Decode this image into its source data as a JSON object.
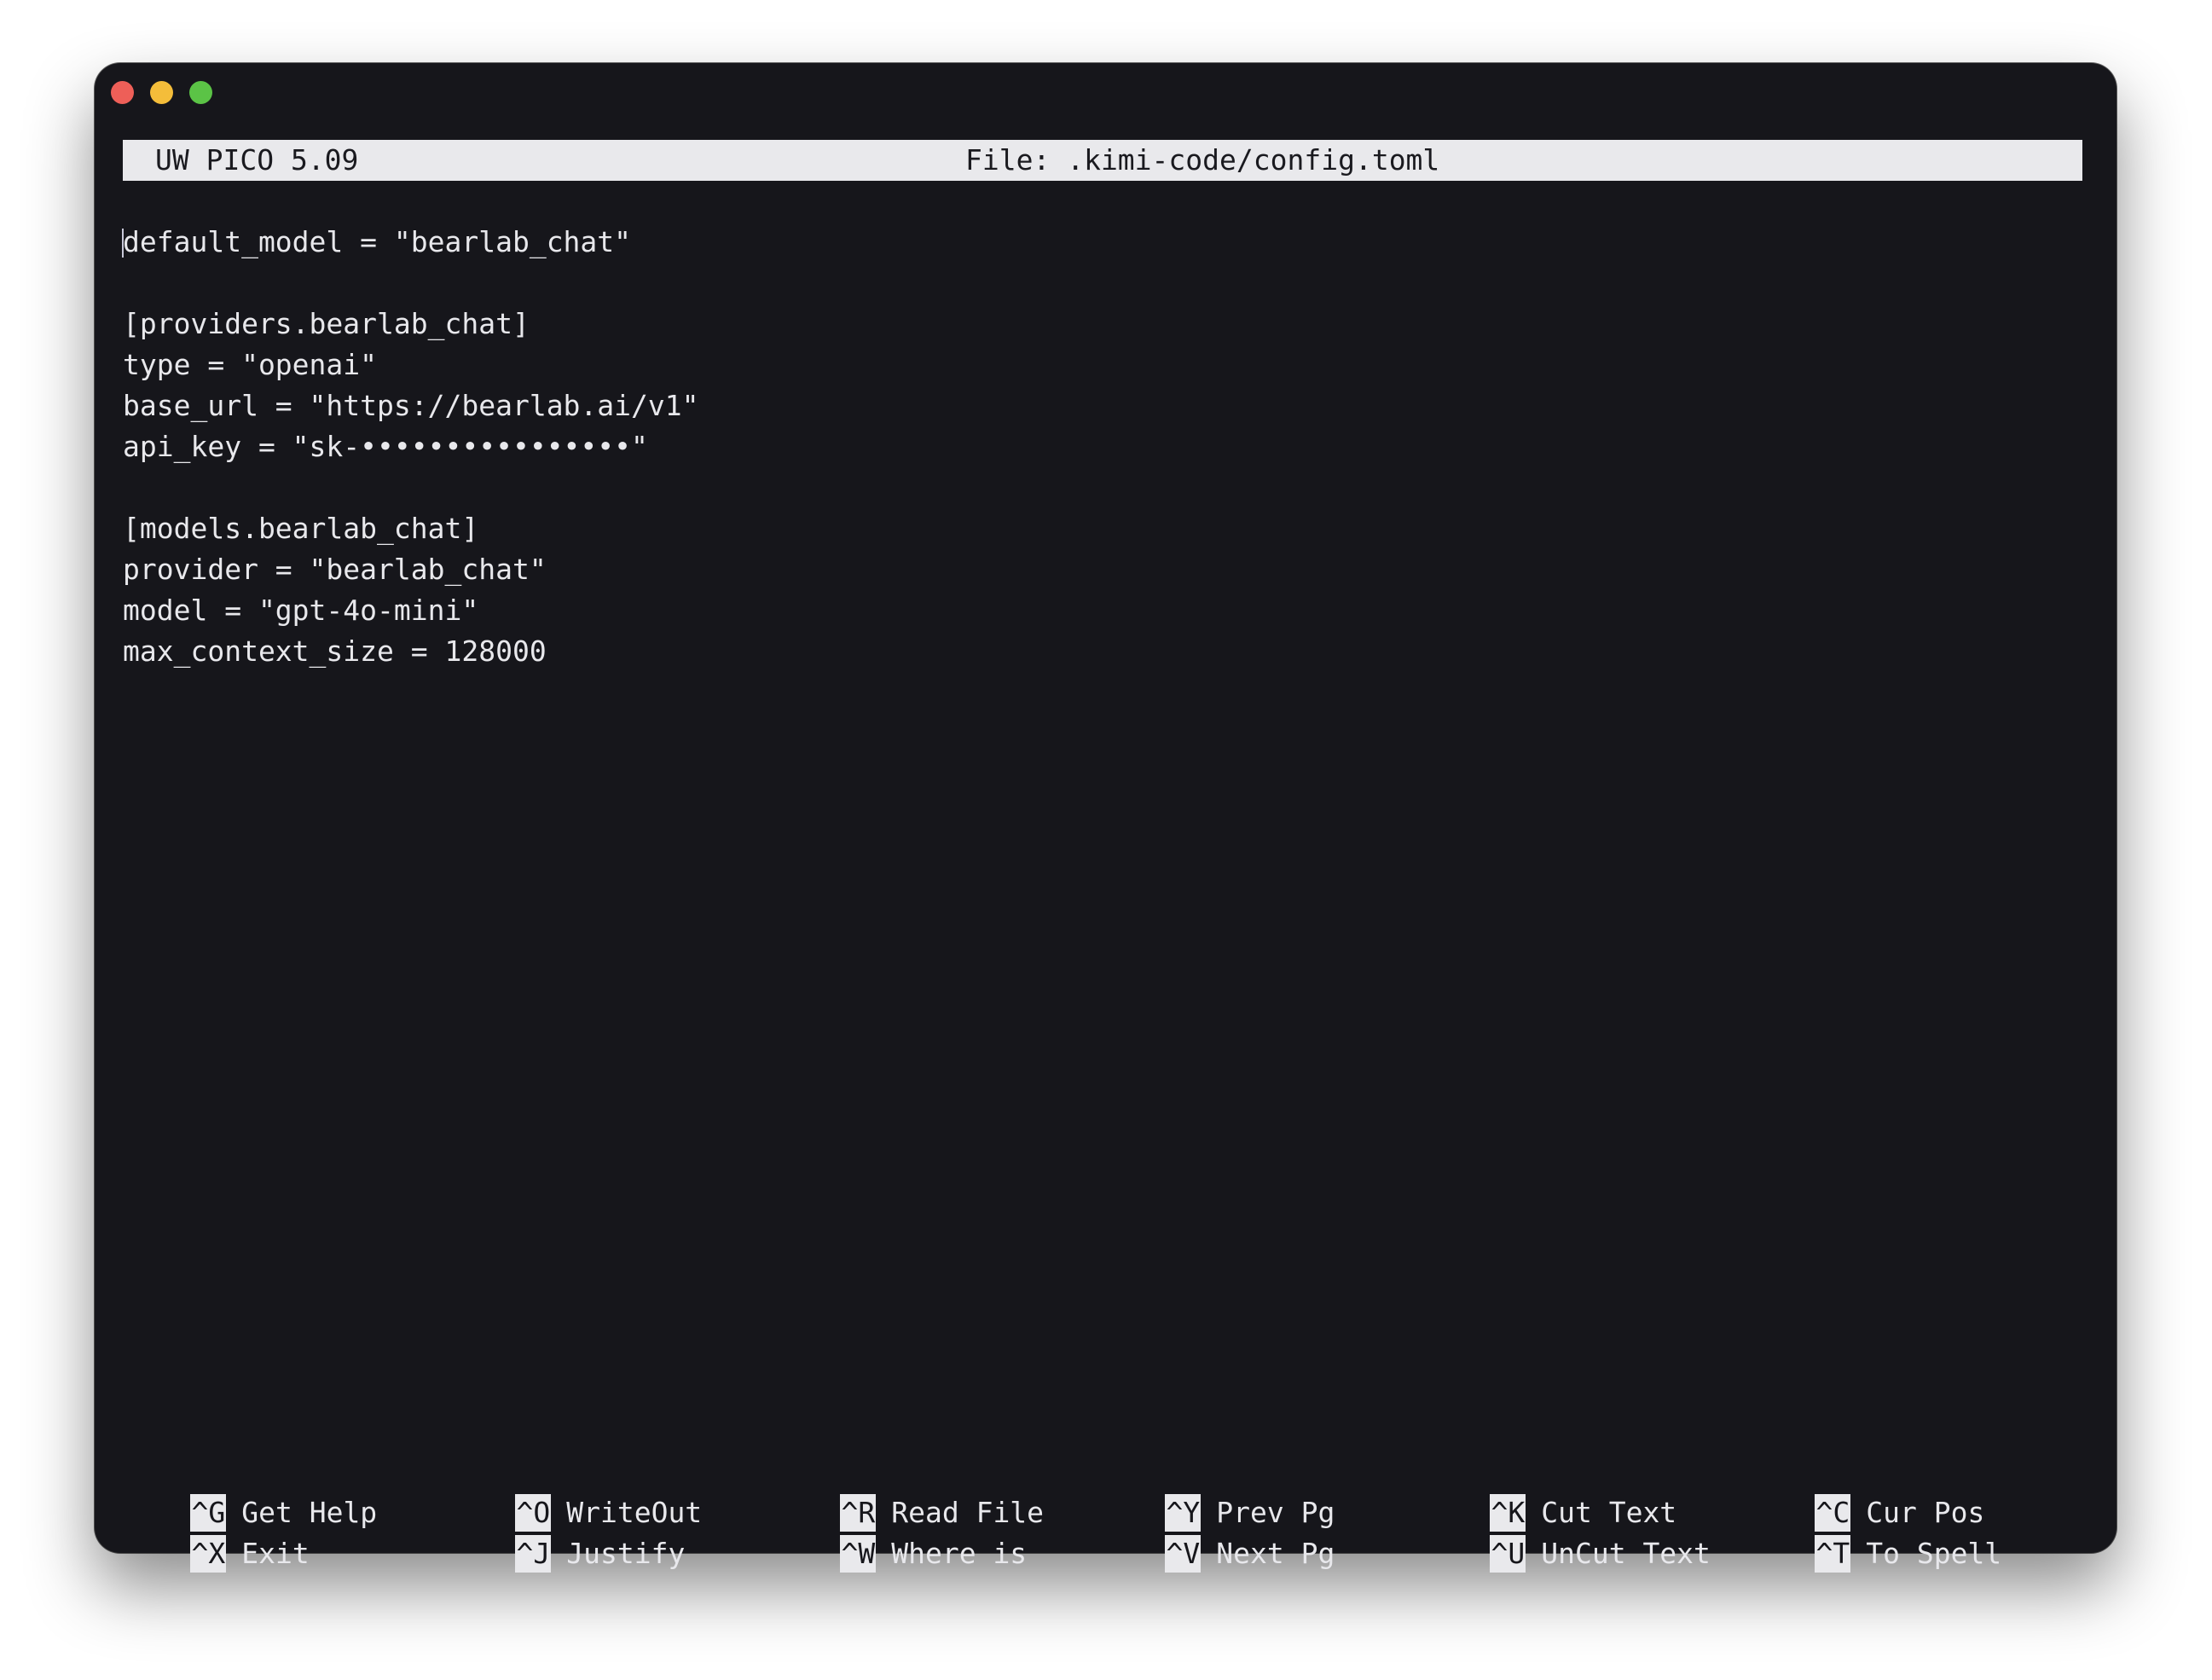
{
  "window": {
    "traffic_lights": {
      "close_color": "#ee5f58",
      "minimize_color": "#f4bd3a",
      "maximize_color": "#5bc346"
    }
  },
  "header": {
    "app_name": "UW PICO 5.09",
    "file_label": "File: .kimi-code/config.toml"
  },
  "editor": {
    "lines": [
      "default_model = \"bearlab_chat\"",
      "",
      "[providers.bearlab_chat]",
      "type = \"openai\"",
      "base_url = \"https://bearlab.ai/v1\"",
      "api_key = \"sk-••••••••••••••••\"",
      "",
      "[models.bearlab_chat]",
      "provider = \"bearlab_chat\"",
      "model = \"gpt-4o-mini\"",
      "max_context_size = 128000"
    ]
  },
  "shortcuts": {
    "row1": [
      {
        "key": "^G",
        "label": "Get Help"
      },
      {
        "key": "^O",
        "label": "WriteOut"
      },
      {
        "key": "^R",
        "label": "Read File"
      },
      {
        "key": "^Y",
        "label": "Prev Pg"
      },
      {
        "key": "^K",
        "label": "Cut Text"
      },
      {
        "key": "^C",
        "label": "Cur Pos"
      }
    ],
    "row2": [
      {
        "key": "^X",
        "label": "Exit"
      },
      {
        "key": "^J",
        "label": "Justify"
      },
      {
        "key": "^W",
        "label": "Where is"
      },
      {
        "key": "^V",
        "label": "Next Pg"
      },
      {
        "key": "^U",
        "label": "UnCut Text"
      },
      {
        "key": "^T",
        "label": "To Spell"
      }
    ]
  }
}
